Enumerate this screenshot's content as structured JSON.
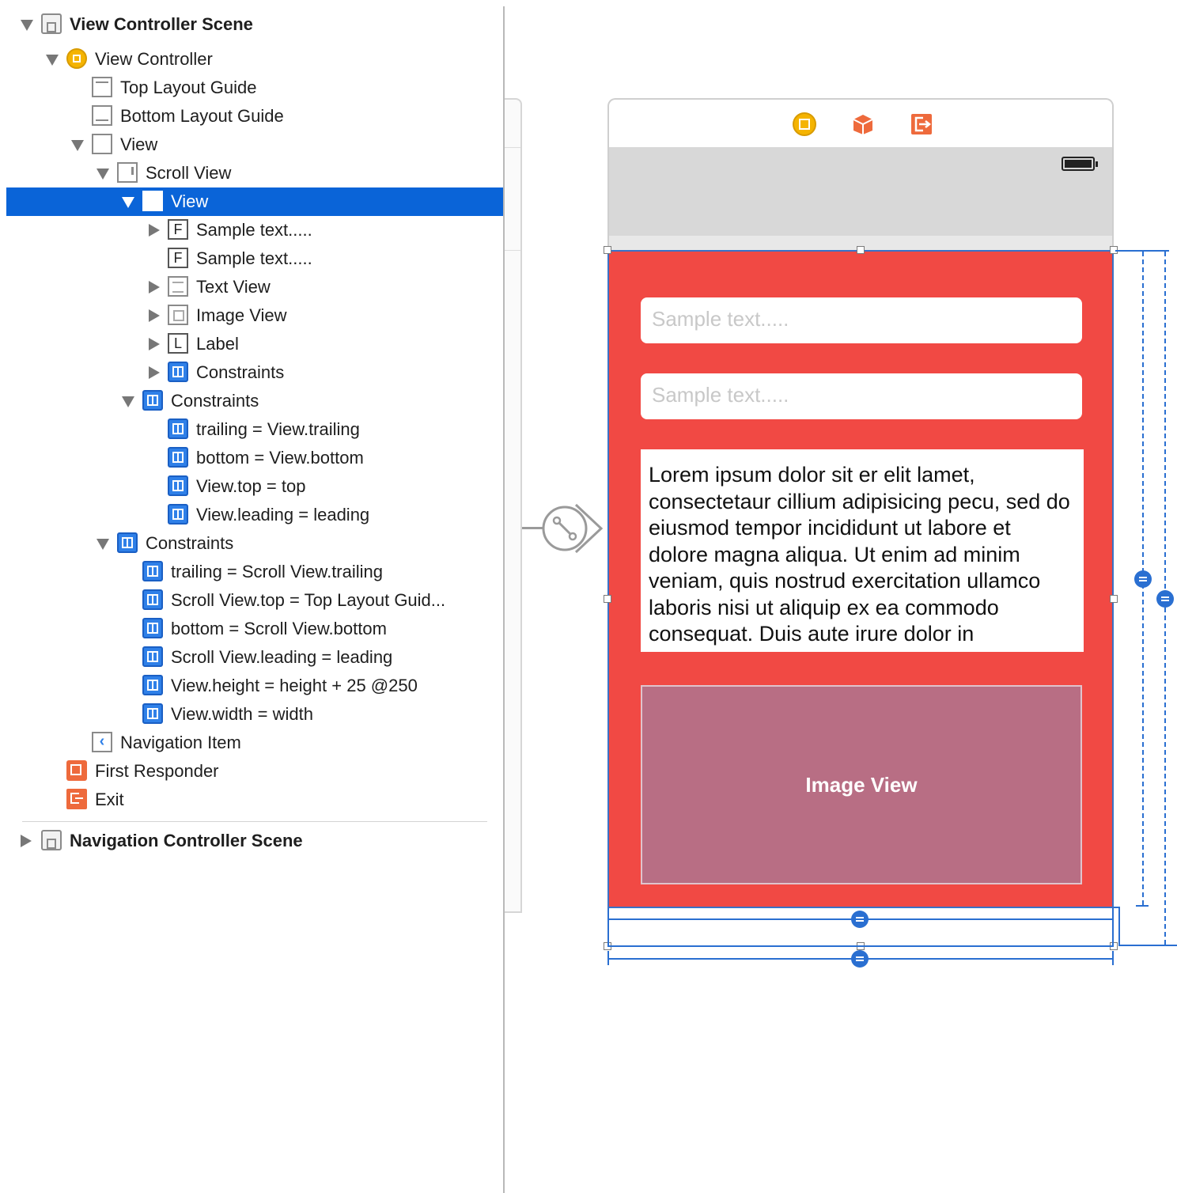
{
  "outline": {
    "rows": [
      {
        "id": "view-controller-scene",
        "label": "View Controller Scene",
        "bold": true
      },
      {
        "id": "view-controller",
        "label": "View Controller"
      },
      {
        "id": "top-layout-guide",
        "label": "Top Layout Guide"
      },
      {
        "id": "bottom-layout-guide",
        "label": "Bottom Layout Guide"
      },
      {
        "id": "view",
        "label": "View"
      },
      {
        "id": "scroll-view",
        "label": "Scroll View"
      },
      {
        "id": "content-view",
        "label": "View",
        "selected": true
      },
      {
        "id": "text-field-1",
        "label": "Sample text.....",
        "icon_letter": "F"
      },
      {
        "id": "text-field-2",
        "label": "Sample text.....",
        "icon_letter": "F"
      },
      {
        "id": "text-view",
        "label": "Text View"
      },
      {
        "id": "image-view",
        "label": "Image View"
      },
      {
        "id": "label",
        "label": "Label",
        "icon_letter": "L"
      },
      {
        "id": "constraints-content",
        "label": "Constraints"
      },
      {
        "id": "constraints-scroll",
        "label": "Constraints"
      },
      {
        "id": "c-trailing-1",
        "label": "trailing = View.trailing"
      },
      {
        "id": "c-bottom-1",
        "label": "bottom = View.bottom"
      },
      {
        "id": "c-top-1",
        "label": "View.top = top"
      },
      {
        "id": "c-leading-1",
        "label": "View.leading = leading"
      },
      {
        "id": "constraints-view",
        "label": "Constraints"
      },
      {
        "id": "c-trailing-2",
        "label": "trailing = Scroll View.trailing"
      },
      {
        "id": "c-top-2",
        "label": "Scroll View.top = Top Layout Guid..."
      },
      {
        "id": "c-bottom-2",
        "label": "bottom = Scroll View.bottom"
      },
      {
        "id": "c-leading-2",
        "label": "Scroll View.leading = leading"
      },
      {
        "id": "c-height",
        "label": "View.height = height + 25 @250"
      },
      {
        "id": "c-width",
        "label": "View.width = width"
      },
      {
        "id": "navigation-item",
        "label": "Navigation Item"
      },
      {
        "id": "first-responder",
        "label": "First Responder"
      },
      {
        "id": "exit",
        "label": "Exit"
      },
      {
        "id": "navigation-controller-scene",
        "label": "Navigation Controller Scene",
        "bold": true
      }
    ]
  },
  "canvas": {
    "scene_bar_icons": [
      "view-controller-icon",
      "first-responder-icon",
      "exit-icon"
    ],
    "text_field_1_placeholder": "Sample text.....",
    "text_field_2_placeholder": "Sample text.....",
    "text_view_text": "Lorem ipsum dolor sit er elit lamet, consectetaur cillium adipisicing pecu, sed do eiusmod tempor incididunt ut labore et dolore magna aliqua. Ut enim ad minim veniam, quis nostrud exercitation ullamco laboris nisi ut aliquip ex ea commodo consequat. Duis aute irure dolor in",
    "image_view_label": "Image View"
  },
  "colors": {
    "selection": "#0a64d8",
    "content_view_background": "#f14944",
    "image_view_background": "#b86e84",
    "constraint_blue": "#2a6fd1",
    "view_controller_yellow": "#f5b400",
    "responder_orange": "#ee6a3c"
  }
}
